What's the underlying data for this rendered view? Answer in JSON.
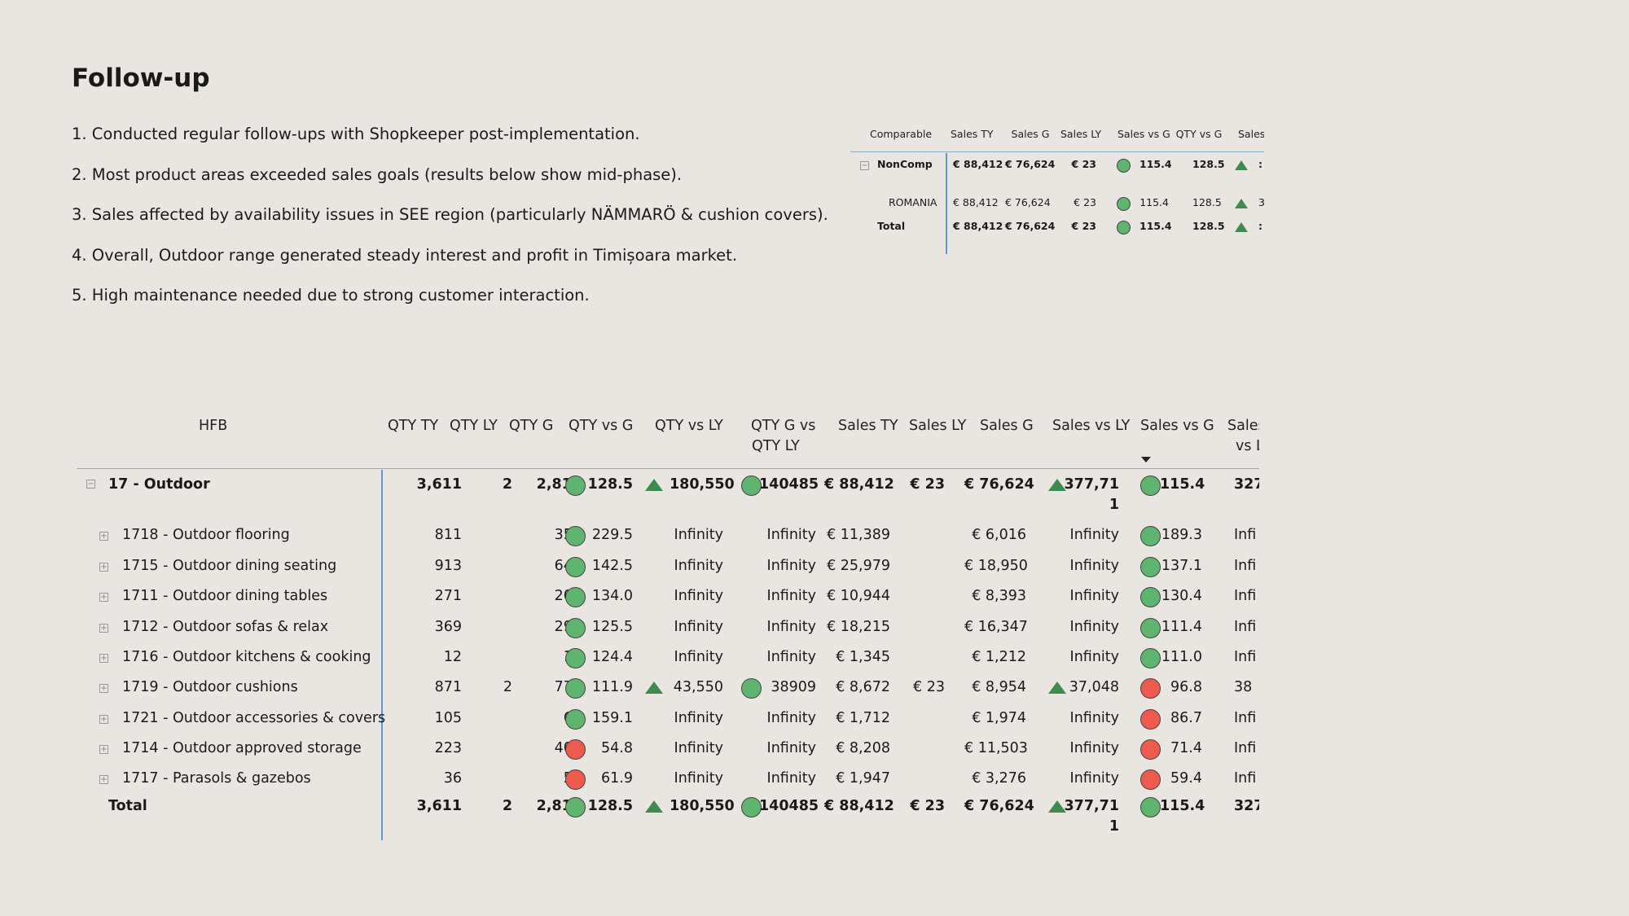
{
  "title": "Follow-up",
  "notes": [
    "1. Conducted regular follow-ups with Shopkeeper post-implementation.",
    "2. Most product areas exceeded sales goals (results below show mid-phase).",
    "3. Sales affected by availability issues in SEE region (particularly NÄMMARÖ & cushion covers).",
    "4. Overall, Outdoor range generated steady interest and profit in Timișoara market.",
    "5. High maintenance needed due to strong customer interaction."
  ],
  "comparable_table": {
    "headers": [
      "Comparable",
      "Sales TY",
      "Sales G",
      "Sales LY",
      "Sales vs G",
      "QTY vs G",
      "Sales"
    ],
    "rows": [
      {
        "label": "NonComp",
        "sales_ty": "€ 88,412",
        "sales_g": "€ 76,624",
        "sales_ly": "€ 23",
        "sales_vs_g": "115.4",
        "sales_vs_g_status": "green",
        "qty_vs_g": "128.5",
        "last": ":",
        "bold": true
      },
      {
        "label": "ROMANIA",
        "sales_ty": "€ 88,412",
        "sales_g": "€ 76,624",
        "sales_ly": "€ 23",
        "sales_vs_g": "115.4",
        "sales_vs_g_status": "green",
        "qty_vs_g": "128.5",
        "last": "3",
        "bold": false
      },
      {
        "label": "Total",
        "sales_ty": "€ 88,412",
        "sales_g": "€ 76,624",
        "sales_ly": "€ 23",
        "sales_vs_g": "115.4",
        "sales_vs_g_status": "green",
        "qty_vs_g": "128.5",
        "last": ":",
        "bold": true
      }
    ]
  },
  "hfb_table": {
    "headers": {
      "hfb": "HFB",
      "qty_ty": "QTY TY",
      "qty_ly": "QTY LY",
      "qty_g": "QTY G",
      "qty_vs_g": "QTY vs G",
      "qty_vs_ly": "QTY vs LY",
      "qty_g_vs_ly_1": "QTY G vs",
      "qty_g_vs_ly_2": "QTY LY",
      "sales_ty": "Sales TY",
      "sales_ly": "Sales LY",
      "sales_g": "Sales G",
      "sales_vs_ly": "Sales vs LY",
      "sales_vs_g": "Sales vs G",
      "last_1": "Sales",
      "last_2": "vs L"
    },
    "parent": {
      "label": "17 - Outdoor",
      "qty_ty": "3,611",
      "qty_ly": "2",
      "qty_g": "2,810",
      "qty_vs_g": "128.5",
      "qty_vs_g_status": "green",
      "qty_vs_ly": "180,550",
      "qty_g_vs_ly": "140485",
      "sales_ty": "€ 88,412",
      "sales_ly": "€ 23",
      "sales_g": "€ 76,624",
      "sales_vs_ly_1": "377,71",
      "sales_vs_ly_2": "1",
      "sales_vs_g": "115.4",
      "sales_vs_g_status": "green",
      "last": "327"
    },
    "rows": [
      {
        "label": "1718 - Outdoor flooring",
        "qty_ty": "811",
        "qty_ly": "",
        "qty_g": "353",
        "qty_vs_g": "229.5",
        "qty_vs_g_status": "green",
        "qty_vs_ly": "Infinity",
        "qty_g_vs_ly": "Infinity",
        "sales_ty": "€ 11,389",
        "sales_ly": "",
        "sales_g": "€ 6,016",
        "sales_vs_ly": "Infinity",
        "sales_vs_g": "189.3",
        "sales_vs_g_status": "green",
        "last": "Infi"
      },
      {
        "label": "1715 - Outdoor dining seating",
        "qty_ty": "913",
        "qty_ly": "",
        "qty_g": "641",
        "qty_vs_g": "142.5",
        "qty_vs_g_status": "green",
        "qty_vs_ly": "Infinity",
        "qty_g_vs_ly": "Infinity",
        "sales_ty": "€ 25,979",
        "sales_ly": "",
        "sales_g": "€ 18,950",
        "sales_vs_ly": "Infinity",
        "sales_vs_g": "137.1",
        "sales_vs_g_status": "green",
        "last": "Infi"
      },
      {
        "label": "1711 - Outdoor dining tables",
        "qty_ty": "271",
        "qty_ly": "",
        "qty_g": "202",
        "qty_vs_g": "134.0",
        "qty_vs_g_status": "green",
        "qty_vs_ly": "Infinity",
        "qty_g_vs_ly": "Infinity",
        "sales_ty": "€ 10,944",
        "sales_ly": "",
        "sales_g": "€ 8,393",
        "sales_vs_ly": "Infinity",
        "sales_vs_g": "130.4",
        "sales_vs_g_status": "green",
        "last": "Infi"
      },
      {
        "label": "1712 - Outdoor sofas & relax",
        "qty_ty": "369",
        "qty_ly": "",
        "qty_g": "294",
        "qty_vs_g": "125.5",
        "qty_vs_g_status": "green",
        "qty_vs_ly": "Infinity",
        "qty_g_vs_ly": "Infinity",
        "sales_ty": "€ 18,215",
        "sales_ly": "",
        "sales_g": "€ 16,347",
        "sales_vs_ly": "Infinity",
        "sales_vs_g": "111.4",
        "sales_vs_g_status": "green",
        "last": "Infi"
      },
      {
        "label": "1716 - Outdoor kitchens & cooking",
        "qty_ty": "12",
        "qty_ly": "",
        "qty_g": "10",
        "qty_vs_g": "124.4",
        "qty_vs_g_status": "green",
        "qty_vs_ly": "Infinity",
        "qty_g_vs_ly": "Infinity",
        "sales_ty": "€ 1,345",
        "sales_ly": "",
        "sales_g": "€ 1,212",
        "sales_vs_ly": "Infinity",
        "sales_vs_g": "111.0",
        "sales_vs_g_status": "green",
        "last": "Infi"
      },
      {
        "label": "1719 - Outdoor cushions",
        "qty_ty": "871",
        "qty_ly": "2",
        "qty_g": "778",
        "qty_vs_g": "111.9",
        "qty_vs_g_status": "green",
        "qty_vs_ly": "43,550",
        "qty_vs_ly_up": true,
        "qty_g_vs_ly": "38909",
        "qty_g_vs_ly_status": "green",
        "sales_ty": "€ 8,672",
        "sales_ly": "€ 23",
        "sales_g": "€ 8,954",
        "sales_vs_ly": "37,048",
        "sales_vs_ly_up": true,
        "sales_vs_g": "96.8",
        "sales_vs_g_status": "red",
        "last": "38"
      },
      {
        "label": "1721 - Outdoor accessories & covers",
        "qty_ty": "105",
        "qty_ly": "",
        "qty_g": "66",
        "qty_vs_g": "159.1",
        "qty_vs_g_status": "green",
        "qty_vs_ly": "Infinity",
        "qty_g_vs_ly": "Infinity",
        "sales_ty": "€ 1,712",
        "sales_ly": "",
        "sales_g": "€ 1,974",
        "sales_vs_ly": "Infinity",
        "sales_vs_g": "86.7",
        "sales_vs_g_status": "red",
        "last": "Infi"
      },
      {
        "label": "1714 - Outdoor approved storage",
        "qty_ty": "223",
        "qty_ly": "",
        "qty_g": "407",
        "qty_vs_g": "54.8",
        "qty_vs_g_status": "red",
        "qty_vs_ly": "Infinity",
        "qty_g_vs_ly": "Infinity",
        "sales_ty": "€ 8,208",
        "sales_ly": "",
        "sales_g": "€ 11,503",
        "sales_vs_ly": "Infinity",
        "sales_vs_g": "71.4",
        "sales_vs_g_status": "red",
        "last": "Infi"
      },
      {
        "label": "1717 - Parasols & gazebos",
        "qty_ty": "36",
        "qty_ly": "",
        "qty_g": "58",
        "qty_vs_g": "61.9",
        "qty_vs_g_status": "red",
        "qty_vs_ly": "Infinity",
        "qty_g_vs_ly": "Infinity",
        "sales_ty": "€ 1,947",
        "sales_ly": "",
        "sales_g": "€ 3,276",
        "sales_vs_ly": "Infinity",
        "sales_vs_g": "59.4",
        "sales_vs_g_status": "red",
        "last": "Infi"
      }
    ],
    "total": {
      "label": "Total",
      "qty_ty": "3,611",
      "qty_ly": "2",
      "qty_g": "2,810",
      "qty_vs_g": "128.5",
      "qty_vs_g_status": "green",
      "qty_vs_ly": "180,550",
      "qty_g_vs_ly": "140485",
      "sales_ty": "€ 88,412",
      "sales_ly": "€ 23",
      "sales_g": "€ 76,624",
      "sales_vs_ly_1": "377,71",
      "sales_vs_ly_2": "1",
      "sales_vs_g": "115.4",
      "sales_vs_g_status": "green",
      "last": "327"
    }
  },
  "colors": {
    "background": "#e9e6e2",
    "green": "#5fb56f",
    "red": "#ee5a4e",
    "triangle": "#3f8a4e",
    "divider": "#5b9bd5"
  }
}
